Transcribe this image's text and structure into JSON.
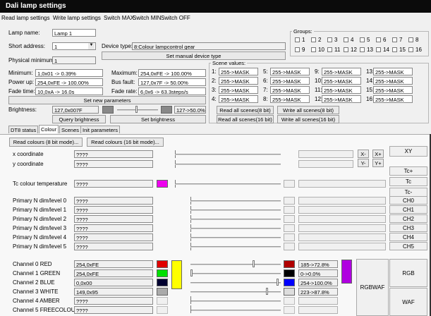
{
  "window": {
    "title": "Dali lamp settings"
  },
  "menu": [
    "Read lamp settings",
    "Write lamp settings",
    "Switch MAX",
    "Switch MIN",
    "Switch OFF"
  ],
  "lamp": {
    "name_label": "Lamp name:",
    "name_value": "Lamp 1",
    "short_address_label": "Short address:",
    "short_address_value": "1",
    "device_type_label": "Device type:",
    "device_type_value": "8:Colour lampcontrol gear",
    "set_device_type_button": "Set manual device type",
    "physical_minimum_label": "Physical minimum:",
    "physical_minimum_value": "1"
  },
  "params": {
    "minimum_label": "Minimum:",
    "minimum_value": "1,0x01 -> 0.39%",
    "maximum_label": "Maximum:",
    "maximum_value": "254,0xFE -> 100.00%",
    "power_up_label": "Power up:",
    "power_up_value": "254,0xFE -> 100.00%",
    "bus_fault_label": "Bus fault:",
    "bus_fault_value": "127,0x7F -> 50.00%",
    "fade_time_label": "Fade time:",
    "fade_time_value": "10,0xA -> 16.0s",
    "fade_rate_label": "Fade rate:",
    "fade_rate_value": "6,0x6 -> 63.3steps/s",
    "set_new_params_button": "Set new parameters"
  },
  "brightness": {
    "label": "Brightness:",
    "value": "127,0x007F",
    "level": 0.5,
    "percent_text": "127->50.0%",
    "query_button": "Query brightness",
    "set_button": "Set brightness"
  },
  "groups": {
    "title": "Groups:",
    "items": [
      "1",
      "2",
      "3",
      "4",
      "5",
      "6",
      "7",
      "8",
      "9",
      "10",
      "11",
      "12",
      "13",
      "14",
      "15",
      "16"
    ]
  },
  "scenes": {
    "title": "Scene values:",
    "items": [
      {
        "n": "1:",
        "v": "255->MASK"
      },
      {
        "n": "5:",
        "v": "255->MASK"
      },
      {
        "n": "9:",
        "v": "255->MASK"
      },
      {
        "n": "13:",
        "v": "255->MASK"
      },
      {
        "n": "2:",
        "v": "255->MASK"
      },
      {
        "n": "6:",
        "v": "255->MASK"
      },
      {
        "n": "10:",
        "v": "255->MASK"
      },
      {
        "n": "14:",
        "v": "255->MASK"
      },
      {
        "n": "3:",
        "v": "255->MASK"
      },
      {
        "n": "7:",
        "v": "255->MASK"
      },
      {
        "n": "11:",
        "v": "255->MASK"
      },
      {
        "n": "15:",
        "v": "255->MASK"
      },
      {
        "n": "4:",
        "v": "255->MASK"
      },
      {
        "n": "8:",
        "v": "255->MASK"
      },
      {
        "n": "12:",
        "v": "255->MASK"
      },
      {
        "n": "16:",
        "v": "255->MASK"
      }
    ],
    "read_8": "Read all scenes(8 bit)",
    "write_8": "Write all scenes(8 bit)",
    "read_16": "Read all scenes(16 bit)",
    "write_16": "Write all scenes(16 bit)"
  },
  "tabs": [
    "DT8 status",
    "Colour",
    "Scenes",
    "Init parameters"
  ],
  "colour": {
    "read_8_button": "Read colours (8 bit mode)...",
    "read_16_button": "Read colours (16 bit mode)...",
    "x_label": "x coordinate",
    "x_value": "????",
    "y_label": "y coordinate",
    "y_value": "????",
    "xy_buttons": [
      "X-",
      "X+",
      "Y-",
      "Y+"
    ],
    "xy_button": "XY",
    "tc_label": "Tc colour temperature",
    "tc_value": "????",
    "tc_buttons": [
      "Tc+",
      "Tc",
      "Tc-"
    ],
    "primaries": [
      {
        "label": "Primary N dim/level 0",
        "value": "????",
        "button": "CH0"
      },
      {
        "label": "Primary N dim/level 1",
        "value": "????",
        "button": "CH1"
      },
      {
        "label": "Primary N dim/level 2",
        "value": "????",
        "button": "CH2"
      },
      {
        "label": "Primary N dim/level 3",
        "value": "????",
        "button": "CH3"
      },
      {
        "label": "Primary N dim/level 4",
        "value": "????",
        "button": "CH4"
      },
      {
        "label": "Primary N dim/level 5",
        "value": "????",
        "button": "CH5"
      }
    ],
    "channels": [
      {
        "label": "Channel 0 RED",
        "value": "254,0xFE",
        "color": "#e00000",
        "level": 0.72,
        "swatch2": "#b00000",
        "text": "185->72.8%"
      },
      {
        "label": "Channel 1 GREEN",
        "value": "254,0xFE",
        "color": "#00e000",
        "level": 0.0,
        "swatch2": "#000000",
        "text": "0->0.0%"
      },
      {
        "label": "Channel 2 BLUE",
        "value": "0,0x00",
        "color": "#000030",
        "level": 1.0,
        "swatch2": "#0000ff",
        "text": "254->100.0%"
      },
      {
        "label": "Channel 3 WHITE",
        "value": "149,0x95",
        "color": "#aaaaaa",
        "level": 0.88,
        "swatch2": "#dddddd",
        "text": "223->87.8%"
      },
      {
        "label": "Channel 4 AMBER",
        "value": "????",
        "color": "",
        "level": null,
        "swatch2": "",
        "text": ""
      },
      {
        "label": "Channel 5 FREECOLOUR",
        "value": "????",
        "color": "",
        "level": null,
        "swatch2": "",
        "text": ""
      }
    ],
    "rgbwaf_button": "RGBWAF",
    "rgb_button": "RGB",
    "waf_button": "WAF",
    "magenta": "#ee00ee",
    "yellow": "#ffff00",
    "purple": "#b000e0"
  }
}
